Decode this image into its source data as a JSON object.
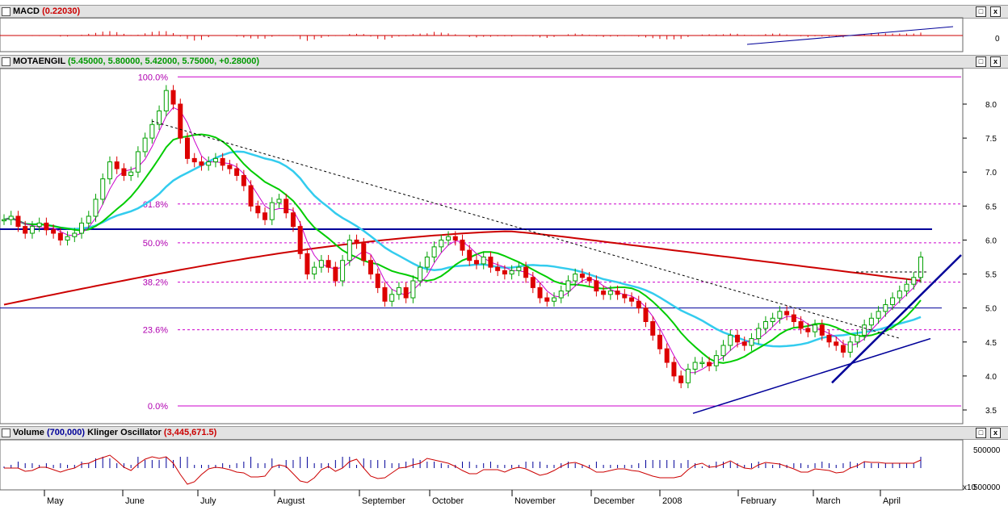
{
  "panels": {
    "macd": {
      "name": "MACD",
      "value": "(0.22030)"
    },
    "price": {
      "name": "MOTAENGIL",
      "ohlc": "(5.45000, 5.80000, 5.42000, 5.75000, +0.28000)"
    },
    "volume": {
      "name": "Volume",
      "value": "(700,000)",
      "osc_name": "Klinger Oscillator",
      "osc_value": "(3,445,671.5)"
    }
  },
  "window_buttons": {
    "restore": "□",
    "close": "x"
  },
  "colors": {
    "candle_up": "#00a000",
    "candle_down": "#dd0000",
    "ma_short": "#cc00cc",
    "ma_medium": "#00cc00",
    "ma_long": "#33ccee",
    "ma_200": "#cc0000",
    "trendline": "#000099",
    "fib": "#cc00cc"
  },
  "chart_data": {
    "type": "candlestick",
    "y_axis": {
      "range": [
        3.4,
        8.4
      ],
      "ticks": [
        "8.0",
        "7.5",
        "7.0",
        "6.5",
        "6.0",
        "5.5",
        "5.0",
        "4.5",
        "4.0",
        "3.5"
      ]
    },
    "macd_axis": {
      "ticks": [
        "0"
      ]
    },
    "volume_axis": {
      "ticks": [
        "500000",
        "x10",
        "500000"
      ]
    },
    "x_months": [
      "May",
      "June",
      "July",
      "August",
      "September",
      "October",
      "November",
      "December",
      "2008",
      "February",
      "March",
      "April"
    ],
    "fibonacci": [
      {
        "label": "100.0%",
        "price": 8.4
      },
      {
        "label": "61.8%",
        "price": 6.53
      },
      {
        "label": "50.0%",
        "price": 5.96
      },
      {
        "label": "38.2%",
        "price": 5.38
      },
      {
        "label": "23.6%",
        "price": 4.68
      },
      {
        "label": "0.0%",
        "price": 3.56
      }
    ],
    "horizontal_lines": [
      6.16,
      5.0
    ],
    "closes": [
      6.3,
      6.35,
      6.2,
      6.1,
      6.2,
      6.25,
      6.15,
      6.1,
      6.0,
      6.05,
      6.1,
      6.25,
      6.35,
      6.6,
      6.9,
      7.15,
      7.05,
      6.95,
      7.0,
      7.3,
      7.5,
      7.7,
      7.9,
      8.2,
      8.0,
      7.5,
      7.2,
      7.15,
      7.1,
      7.15,
      7.2,
      7.1,
      7.05,
      6.95,
      6.8,
      6.5,
      6.4,
      6.3,
      6.55,
      6.6,
      6.4,
      6.2,
      5.8,
      5.5,
      5.6,
      5.7,
      5.6,
      5.4,
      5.7,
      6.0,
      5.95,
      5.7,
      5.5,
      5.3,
      5.1,
      5.2,
      5.3,
      5.15,
      5.4,
      5.6,
      5.75,
      5.9,
      6.0,
      6.05,
      6.0,
      5.85,
      5.7,
      5.65,
      5.75,
      5.6,
      5.55,
      5.5,
      5.55,
      5.6,
      5.45,
      5.3,
      5.15,
      5.1,
      5.15,
      5.25,
      5.4,
      5.5,
      5.45,
      5.4,
      5.25,
      5.2,
      5.25,
      5.2,
      5.15,
      5.1,
      5.0,
      4.8,
      4.6,
      4.4,
      4.2,
      4.0,
      3.9,
      4.1,
      4.2,
      4.2,
      4.15,
      4.3,
      4.45,
      4.6,
      4.5,
      4.45,
      4.55,
      4.7,
      4.8,
      4.85,
      4.95,
      4.9,
      4.8,
      4.7,
      4.65,
      4.75,
      4.6,
      4.5,
      4.45,
      4.35,
      4.5,
      4.6,
      4.75,
      4.85,
      4.95,
      5.05,
      5.15,
      5.25,
      5.35,
      5.45,
      5.75
    ]
  }
}
